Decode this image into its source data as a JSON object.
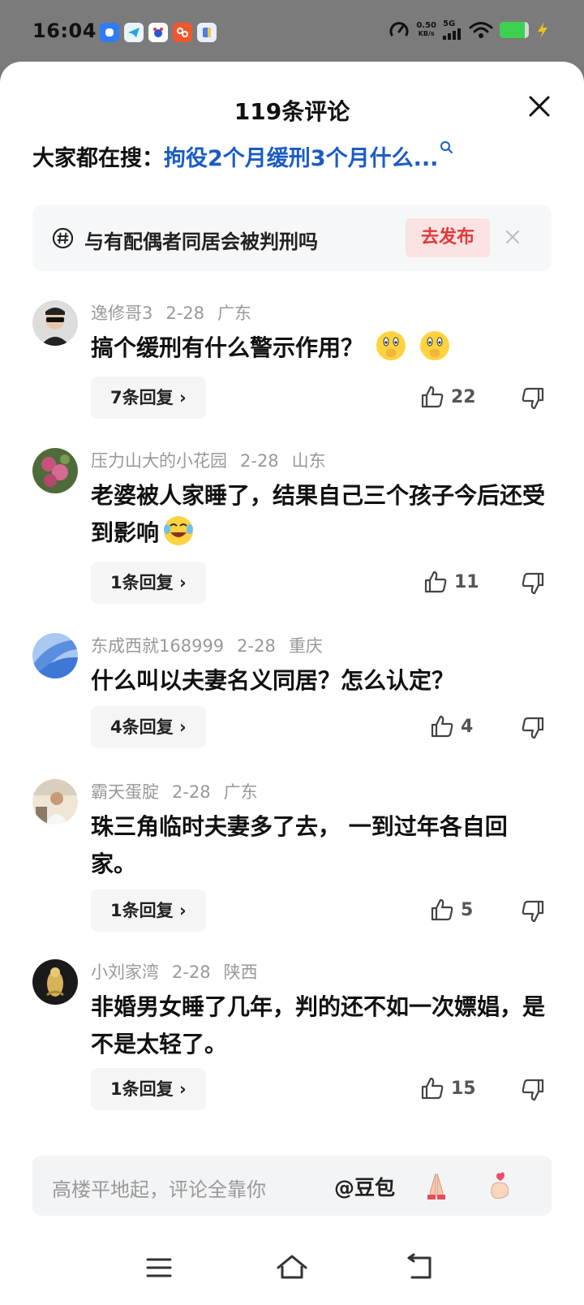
{
  "status_bar": {
    "time": "16:04",
    "net_speed_value": "0.50",
    "net_speed_unit": "KB/s",
    "network": "5G",
    "battery_level": 0.85,
    "app_icons": [
      "link-app-icon",
      "telegram-icon",
      "baidu-icon",
      "huoshan-icon",
      "doc-app-icon"
    ]
  },
  "sheet": {
    "title": "119条评论",
    "close_icon": "close-icon",
    "hot_search": {
      "prefix": "大家都在搜：",
      "term": "拘役2个月缓刑3个月什么...",
      "icon": "search-icon"
    },
    "topic": {
      "icon": "hashtag-icon",
      "text": "与有配偶者同居会被判刑吗",
      "publish_label": "去发布",
      "close_icon": "close-icon"
    }
  },
  "comments": [
    {
      "user": "逸修哥3",
      "date": "2-28",
      "location": "广东",
      "text": "搞个缓刑有什么警示作用？",
      "emojis": [
        "shush-face-emoji",
        "shush-face-emoji"
      ],
      "replies_label": "7条回复",
      "likes": "22"
    },
    {
      "user": "压力山大的小花园",
      "date": "2-28",
      "location": "山东",
      "text": "老婆被人家睡了，结果自己三个孩子今后还受到影响",
      "emojis": [
        "laugh-cry-emoji"
      ],
      "replies_label": "1条回复",
      "likes": "11"
    },
    {
      "user": "东成西就168999",
      "date": "2-28",
      "location": "重庆",
      "text": "什么叫以夫妻名义同居？怎么认定？",
      "emojis": [],
      "replies_label": "4条回复",
      "likes": "4"
    },
    {
      "user": "霸天蛋腚",
      "date": "2-28",
      "location": "广东",
      "text": "珠三角临时夫妻多了去， 一到过年各自回家。",
      "emojis": [],
      "replies_label": "1条回复",
      "likes": "5"
    },
    {
      "user": "小刘家湾",
      "date": "2-28",
      "location": "陕西",
      "text": "非婚男女睡了几年，判的还不如一次嫖娼，是不是太轻了。",
      "emojis": [],
      "replies_label": "1条回复",
      "likes": "15"
    }
  ],
  "input_bar": {
    "placeholder": "高楼平地起，评论全靠你",
    "mention": "@豆包",
    "quick_emojis": [
      "praying-hands-emoji",
      "finger-heart-emoji"
    ]
  },
  "nav_bar": {
    "items": [
      "menu-icon",
      "home-icon",
      "back-icon"
    ]
  },
  "colors": {
    "link_blue": "#1b5cc4",
    "publish_red": "#e13a3a",
    "publish_bg": "#fbe3e3",
    "meta_gray": "#999999"
  }
}
